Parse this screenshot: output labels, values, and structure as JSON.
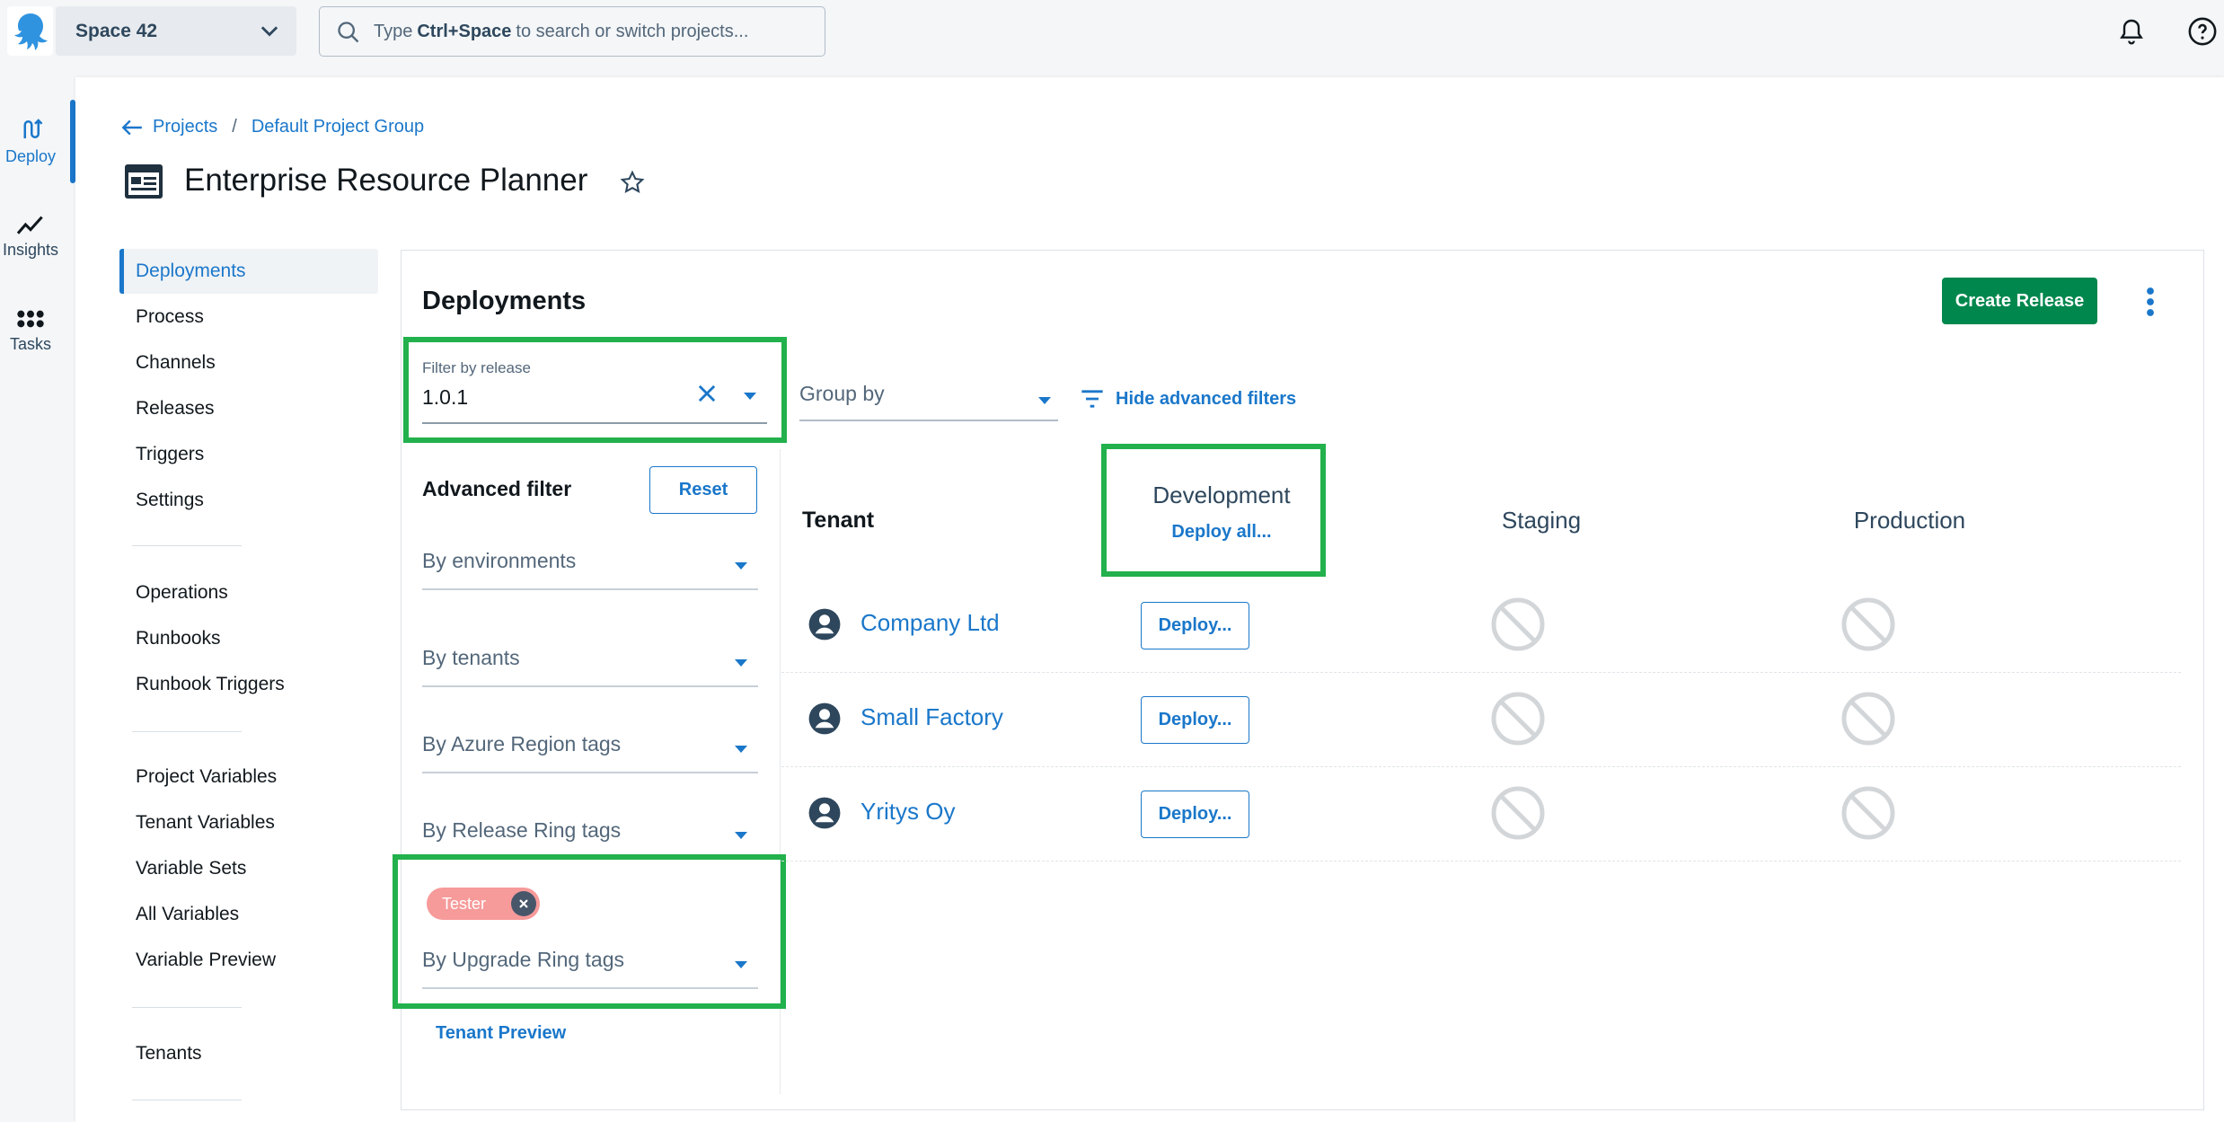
{
  "topbar": {
    "space_name": "Space 42",
    "search_prefix": "Type",
    "search_shortcut": "Ctrl+Space",
    "search_suffix": "to search or switch projects..."
  },
  "rail": {
    "items": [
      {
        "label": "Deploy",
        "icon": "deploy-icon",
        "active": true
      },
      {
        "label": "Insights",
        "icon": "insights-chart-icon",
        "active": false
      },
      {
        "label": "Tasks",
        "icon": "tasks-grid-icon",
        "active": false
      }
    ]
  },
  "breadcrumb": {
    "back": "Projects",
    "separator": "/",
    "group": "Default Project Group"
  },
  "project": {
    "title": "Enterprise Resource Planner"
  },
  "sidenav": {
    "items": [
      {
        "label": "Deployments",
        "active": true
      },
      {
        "label": "Process"
      },
      {
        "label": "Channels"
      },
      {
        "label": "Releases"
      },
      {
        "label": "Triggers"
      },
      {
        "label": "Settings"
      },
      {
        "label": "Operations"
      },
      {
        "label": "Runbooks"
      },
      {
        "label": "Runbook Triggers"
      },
      {
        "label": "Project Variables"
      },
      {
        "label": "Tenant Variables"
      },
      {
        "label": "Variable Sets"
      },
      {
        "label": "All Variables"
      },
      {
        "label": "Variable Preview"
      },
      {
        "label": "Tenants"
      }
    ]
  },
  "deployments": {
    "title": "Deployments",
    "create_release": "Create Release",
    "filter_release": {
      "label": "Filter by release",
      "value": "1.0.1"
    },
    "group_by": "Group by",
    "hide_filters": "Hide advanced filters",
    "advanced": {
      "title": "Advanced filter",
      "reset": "Reset",
      "selects": [
        "By environments",
        "By tenants",
        "By Azure Region tags",
        "By Release Ring tags",
        "By Upgrade Ring tags"
      ],
      "chip": "Tester",
      "tenant_preview": "Tenant Preview"
    },
    "table": {
      "tenant_header": "Tenant",
      "environments": [
        "Development",
        "Staging",
        "Production"
      ],
      "deploy_all": "Deploy all...",
      "deploy_label": "Deploy...",
      "rows": [
        {
          "tenant": "Company Ltd"
        },
        {
          "tenant": "Small Factory"
        },
        {
          "tenant": "Yritys Oy"
        }
      ]
    }
  },
  "colors": {
    "accent": "#1a77ca",
    "primary_button": "#00874d",
    "highlight": "#22b14c",
    "chip": "#f79a9a"
  }
}
